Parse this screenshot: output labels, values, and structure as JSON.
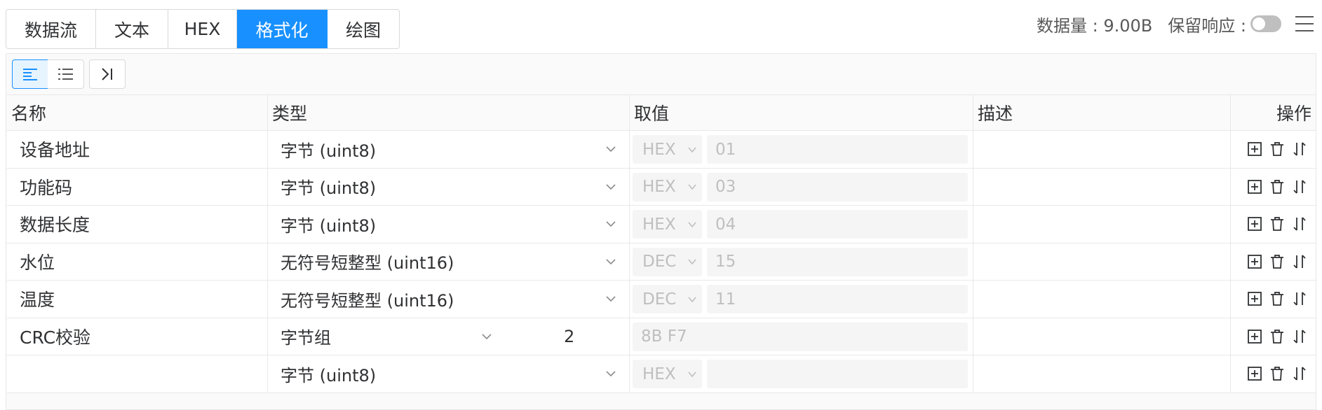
{
  "tabs": [
    {
      "label": "数据流",
      "active": false
    },
    {
      "label": "文本",
      "active": false
    },
    {
      "label": "HEX",
      "active": false
    },
    {
      "label": "格式化",
      "active": true
    },
    {
      "label": "绘图",
      "active": false
    }
  ],
  "status": {
    "data_amount": "数据量 : 9.00B",
    "keep_response": "保留响应 :",
    "keep_response_on": false
  },
  "toolbar": {
    "buttons": [
      "align-left-icon",
      "list-icon",
      "step-end-icon"
    ]
  },
  "table": {
    "headers": [
      "名称",
      "类型",
      "取值",
      "描述",
      "操作"
    ],
    "rows": [
      {
        "name": "设备地址",
        "type": "字节 (uint8)",
        "format": "HEX",
        "value": "01",
        "desc": ""
      },
      {
        "name": "功能码",
        "type": "字节 (uint8)",
        "format": "HEX",
        "value": "03",
        "desc": ""
      },
      {
        "name": "数据长度",
        "type": "字节 (uint8)",
        "format": "HEX",
        "value": "04",
        "desc": ""
      },
      {
        "name": "水位",
        "type": "无符号短整型 (uint16)",
        "format": "DEC",
        "value": "15",
        "desc": ""
      },
      {
        "name": "温度",
        "type": "无符号短整型 (uint16)",
        "format": "DEC",
        "value": "11",
        "desc": ""
      },
      {
        "name": "CRC校验",
        "type": "字节组",
        "count": "2",
        "value": "8B F7",
        "desc": ""
      },
      {
        "name": "",
        "type": "字节 (uint8)",
        "format": "HEX",
        "value": "",
        "desc": ""
      }
    ]
  },
  "colors": {
    "accent": "#1890ff",
    "disabled_text": "#bfbfbf",
    "border": "#e8e8e8"
  }
}
